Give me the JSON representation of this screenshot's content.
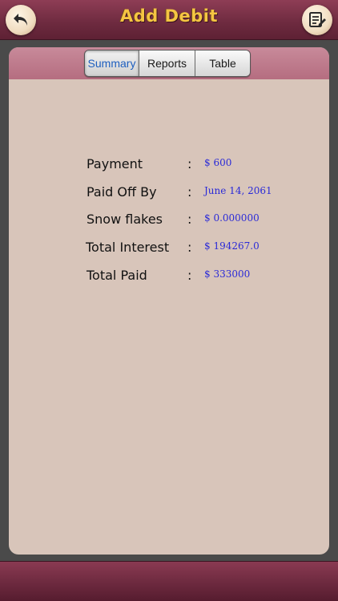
{
  "header": {
    "title": "Add Debit",
    "back_icon": "undo-arrow-icon",
    "edit_icon": "notes-edit-icon"
  },
  "tabs": [
    {
      "label": "Summary",
      "active": true
    },
    {
      "label": "Reports",
      "active": false
    },
    {
      "label": "Table",
      "active": false
    }
  ],
  "summary": {
    "colon": ":",
    "rows": [
      {
        "label": "Payment",
        "value": "$ 600"
      },
      {
        "label": "Paid Off By",
        "value": "June 14, 2061"
      },
      {
        "label": "Snow flakes",
        "value": "$ 0.000000"
      },
      {
        "label": "Total Interest",
        "value": "$ 194267.0"
      },
      {
        "label": "Total Paid",
        "value": "$ 333000"
      }
    ]
  },
  "colors": {
    "header": "#6d2a3f",
    "title": "#f5c542",
    "panel": "#d8c5ba",
    "value_text": "#2a2ad8",
    "active_tab": "#1e5fbf"
  }
}
